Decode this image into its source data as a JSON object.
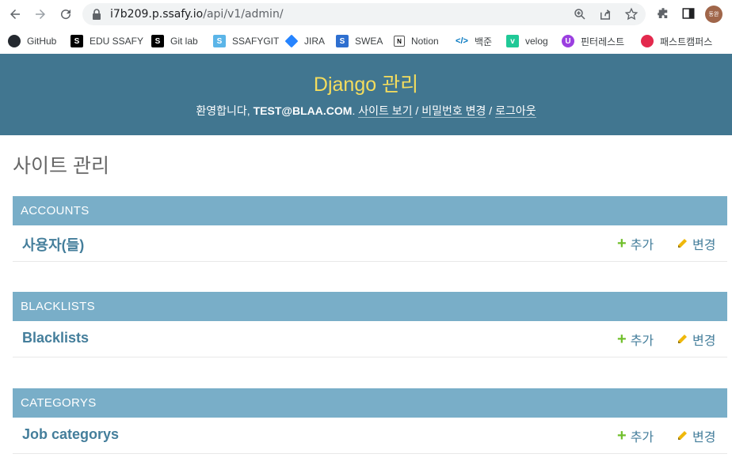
{
  "browser": {
    "url_host": "i7b209.p.ssafy.io",
    "url_path": "/api/v1/admin/",
    "avatar_text": "동완"
  },
  "bookmarks": [
    {
      "label": "GitHub",
      "icon": "github-icon"
    },
    {
      "label": "EDU SSAFY",
      "icon": "ssafy-icon"
    },
    {
      "label": "Git lab",
      "icon": "gitlab-icon"
    },
    {
      "label": "SSAFYGIT",
      "icon": "ssafygit-icon"
    },
    {
      "label": "JIRA",
      "icon": "jira-icon"
    },
    {
      "label": "SWEA",
      "icon": "swea-icon"
    },
    {
      "label": "Notion",
      "icon": "notion-icon"
    },
    {
      "label": "백준",
      "icon": "baekjoon-icon"
    },
    {
      "label": "velog",
      "icon": "velog-icon"
    },
    {
      "label": "핀터레스트",
      "icon": "pinterest-icon"
    },
    {
      "label": "패스트캠퍼스",
      "icon": "fastcampus-icon"
    }
  ],
  "header": {
    "brand": "Django 관리",
    "welcome": "환영합니다,",
    "user": "test@blaa.com",
    "view_site": "사이트 보기",
    "change_password": "비밀번호 변경",
    "logout": "로그아웃"
  },
  "page_title": "사이트 관리",
  "modules": [
    {
      "caption": "ACCOUNTS",
      "model": "사용자(들)",
      "add": "추가",
      "change": "변경"
    },
    {
      "caption": "BLACKLISTS",
      "model": "Blacklists",
      "add": "추가",
      "change": "변경"
    },
    {
      "caption": "CATEGORYS",
      "model": "Job categorys",
      "add": "추가",
      "change": "변경"
    }
  ],
  "colors": {
    "header_bg": "#417690",
    "brand": "#f5dd5d",
    "caption_bg": "#79aec8",
    "link": "#447e9b",
    "add_icon": "#70bf2b",
    "change_icon": "#efb80b"
  }
}
